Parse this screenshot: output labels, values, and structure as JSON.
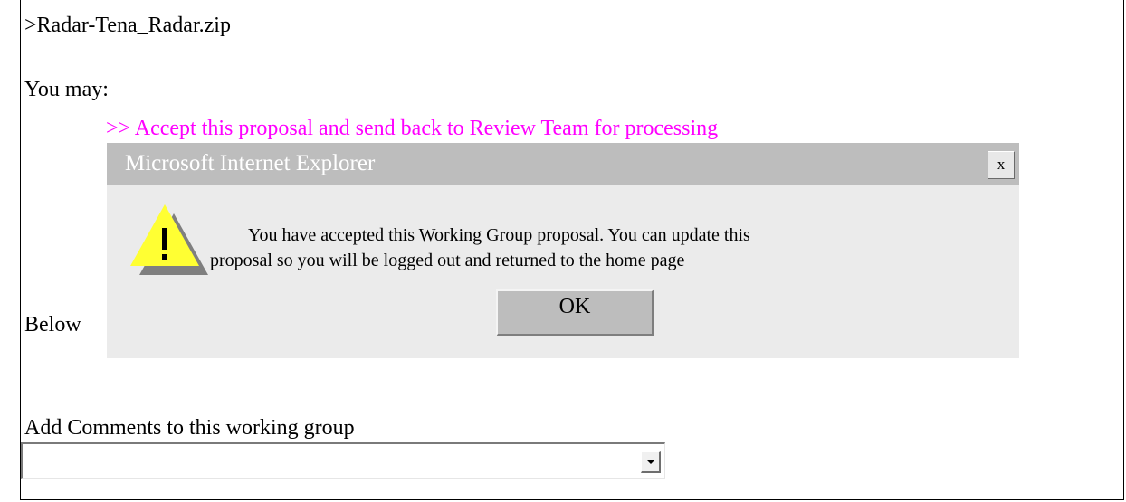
{
  "page": {
    "filename": ">Radar-Tena_Radar.zip",
    "you_may": "You may:",
    "accept_link": ">> Accept this proposal and send back to Review Team for processing",
    "below_label": "Below",
    "add_comments_label": "Add Comments to this working group",
    "comments_select_value": ""
  },
  "dialog": {
    "title": "Microsoft Internet Explorer",
    "close_label": "x",
    "message_line1": "You have accepted this Working Group proposal.  You can update this",
    "message_line2": "proposal so you will be logged out and returned to the home page",
    "ok_label": "OK",
    "icon": "warning-icon"
  },
  "colors": {
    "link": "#ff00ff",
    "dialog_bg": "#ebebeb",
    "titlebar_bg": "#bdbdbd",
    "warning_fill": "#ffff33"
  }
}
